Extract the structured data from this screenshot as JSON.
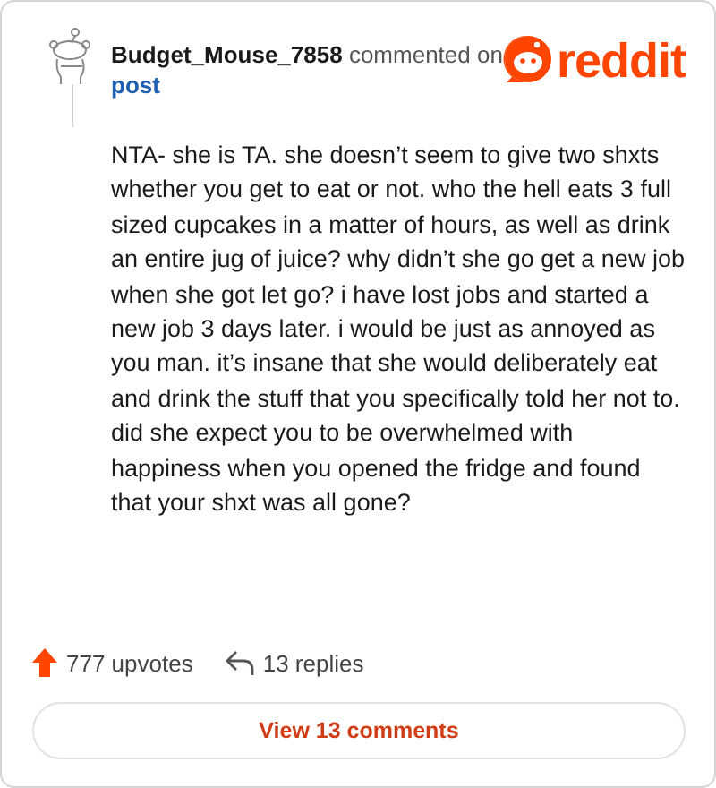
{
  "comment": {
    "author": "Budget_Mouse_7858",
    "action": "commented on",
    "target": "post",
    "logo": "reddit",
    "body": "NTA- she is TA. she doesn’t seem to give two shxts whether you get to eat or not. who the hell eats 3 full sized cupcakes in a matter of hours, as well as drink an entire jug of juice? why didn’t she go get a new job when she got let go? i have lost jobs and started a new job 3 days later. i would be just as annoyed as you man. it’s insane that she would deliberately eat and drink the stuff that you specifically told her not to. did she expect you to be overwhelmed with happiness when you opened the fridge and found that your shxt was all gone?",
    "upvotes": "777 upvotes",
    "replies": "13 replies"
  },
  "view_button": "View 13 comments"
}
